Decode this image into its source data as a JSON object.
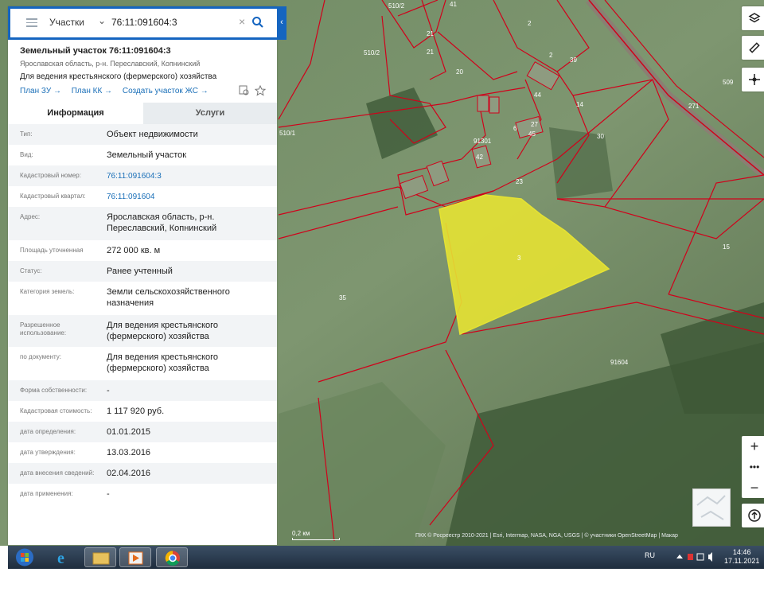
{
  "search": {
    "type_label": "Участки",
    "value": "76:11:091604:3"
  },
  "parcel": {
    "title": "Земельный участок 76:11:091604:3",
    "address": "Ярославская область, р-н. Переславский, Копнинский",
    "usage": "Для ведения крестьянского (фермерского) хозяйства",
    "links": [
      "План ЗУ →",
      "План КК →",
      "Создать участок ЖС →"
    ]
  },
  "tabs": [
    "Информация",
    "Услуги"
  ],
  "info_rows": [
    {
      "label": "Тип:",
      "value": "Объект недвижимости"
    },
    {
      "label": "Вид:",
      "value": "Земельный участок"
    },
    {
      "label": "Кадастровый номер:",
      "value": "76:11:091604:3"
    },
    {
      "label": "Кадастровый квартал:",
      "value": "76:11:091604"
    },
    {
      "label": "Адрес:",
      "value": "Ярославская область, р-н. Переславский, Копнинский"
    },
    {
      "label": "Площадь уточненная",
      "value": "272 000 кв. м"
    },
    {
      "label": "Статус:",
      "value": "Ранее учтенный"
    },
    {
      "label": "Категория земель:",
      "value": "Земли сельскохозяйственного назначения"
    },
    {
      "label": "Разрешенное использование:",
      "value": "Для ведения крестьянского (фермерского) хозяйства"
    },
    {
      "label": "по документу:",
      "value": "Для ведения крестьянского (фермерского) хозяйства"
    },
    {
      "label": "Форма собственности:",
      "value": "-"
    },
    {
      "label": "Кадастровая стоимость:",
      "value": "1 117 920 руб."
    },
    {
      "label": "дата определения:",
      "value": "01.01.2015"
    },
    {
      "label": "дата утверждения:",
      "value": "13.03.2016"
    },
    {
      "label": "дата внесения сведений:",
      "value": "02.04.2016"
    },
    {
      "label": "дата применения:",
      "value": "-"
    }
  ],
  "map": {
    "labels": [
      "510/2",
      "41",
      "2",
      "21",
      "21",
      "20",
      "510/2",
      "2",
      "39",
      "509",
      "510/1",
      "44",
      "14",
      "27",
      "45",
      "6",
      "91301",
      "30",
      "42",
      "271",
      "23",
      "3",
      "15",
      "35",
      "91604"
    ],
    "scale": "0,2 км",
    "attribution": "ПКК © Росреестр 2010-2021 | Esri, Intermap, NASA, NGA, USGS | © участники OpenStreetMap | Макар"
  },
  "taskbar": {
    "lang": "RU",
    "time": "14:46",
    "date": "17.11.2021"
  },
  "colors": {
    "accent": "#1565c0",
    "parcel_fill": "#e5e233",
    "boundary": "#d0021b"
  }
}
